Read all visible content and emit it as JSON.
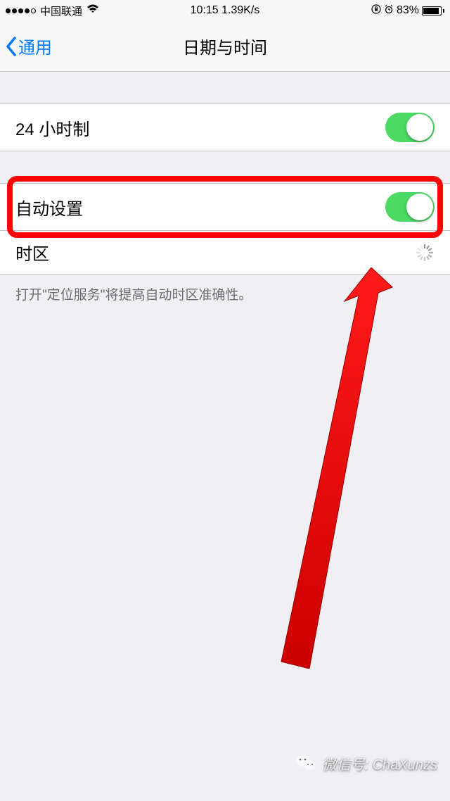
{
  "status": {
    "carrier": "中国联通",
    "time": "10:15 1.39K/s",
    "battery_pct": "83%"
  },
  "nav": {
    "back_label": "通用",
    "title": "日期与时间"
  },
  "rows": {
    "hour24_label": "24 小时制",
    "auto_label": "自动设置",
    "timezone_label": "时区"
  },
  "footer": {
    "note": "打开\"定位服务\"将提高自动时区准确性。"
  },
  "watermark": {
    "text": "微信号: ChaXunzs"
  }
}
